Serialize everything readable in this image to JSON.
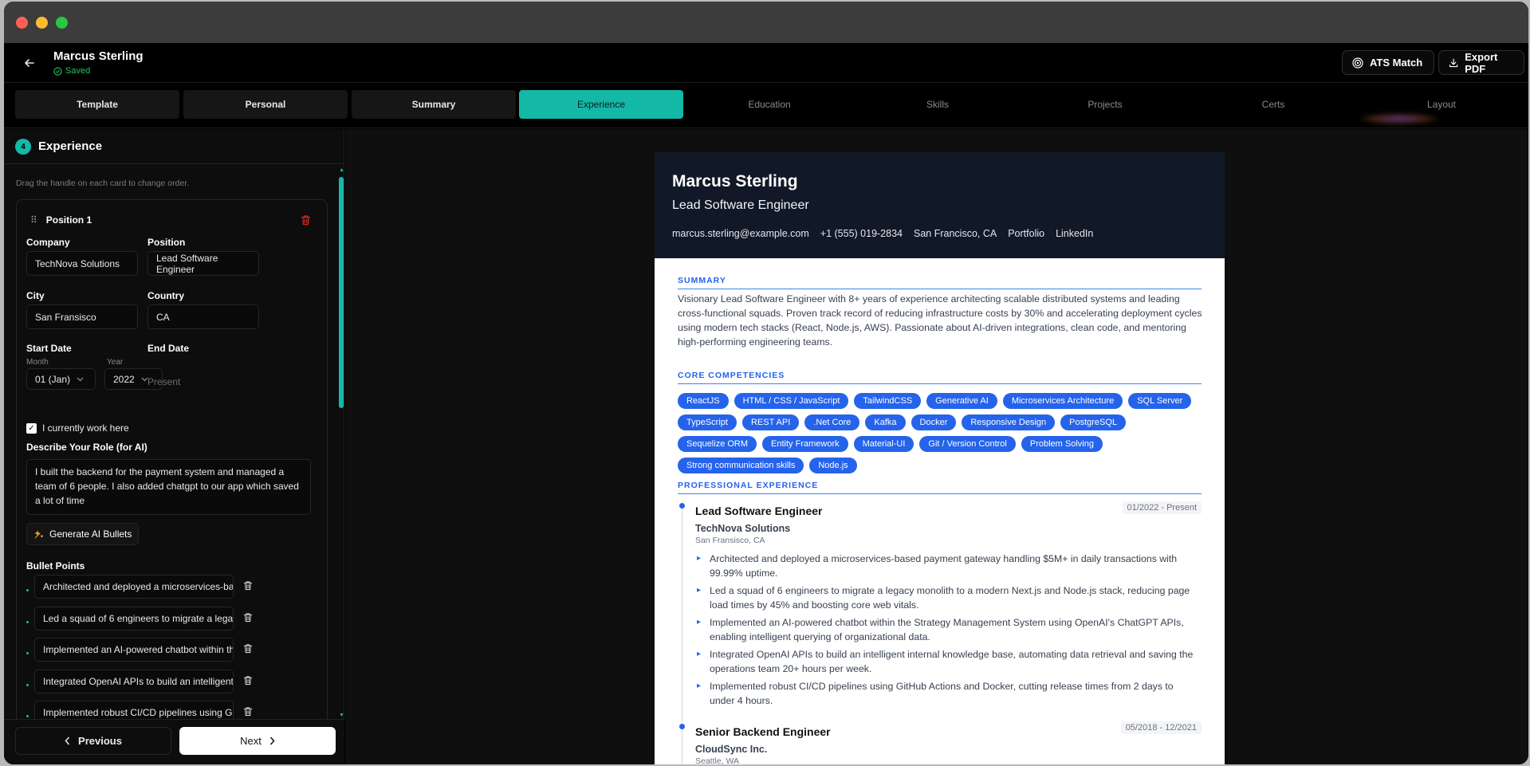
{
  "header": {
    "name": "Marcus Sterling",
    "status": "Saved",
    "ats_label": "ATS Match",
    "export_label": "Export PDF"
  },
  "tabs": [
    "Template",
    "Personal",
    "Summary",
    "Experience",
    "Education",
    "Skills",
    "Projects",
    "Certs",
    "Layout"
  ],
  "section": {
    "number": "4",
    "title": "Experience",
    "hint": "Drag the handle on each card to change order."
  },
  "position": {
    "title": "Position 1",
    "company_label": "Company",
    "company": "TechNova Solutions",
    "position_label": "Position",
    "position": "Lead Software Engineer",
    "city_label": "City",
    "city": "San Fransisco",
    "country_label": "Country",
    "country": "CA",
    "start_label": "Start Date",
    "month_label": "Month",
    "month": "01 (Jan)",
    "year_label": "Year",
    "year": "2022",
    "end_label": "End Date",
    "end_placeholder": "Present",
    "current_label": "I currently work here",
    "role_label": "Describe Your Role (for AI)",
    "role_text": "I built the backend for the payment system and managed a team of 6 people. I also added chatgpt to our app which saved a lot of time",
    "generate_label": "Generate AI Bullets",
    "bullets_label": "Bullet Points",
    "bullets": [
      "Architected and deployed a microservices-based payment gateway handling",
      "Led a squad of 6 engineers to migrate a legacy monolith",
      "Implemented an AI-powered chatbot within the Strategy",
      "Integrated OpenAI APIs to build an intelligent internal",
      "Implemented robust CI/CD pipelines using GitHub Actions"
    ]
  },
  "footer": {
    "prev": "Previous",
    "next": "Next"
  },
  "resume": {
    "name": "Marcus Sterling",
    "title": "Lead Software Engineer",
    "contact": [
      "marcus.sterling@example.com",
      "+1 (555) 019-2834",
      "San Francisco, CA",
      "Portfolio",
      "LinkedIn"
    ],
    "summary_heading": "SUMMARY",
    "summary": "Visionary Lead Software Engineer with 8+ years of experience architecting scalable distributed systems and leading cross-functional squads. Proven track record of reducing infrastructure costs by 30% and accelerating deployment cycles using modern tech stacks (React, Node.js, AWS). Passionate about AI-driven integrations, clean code, and mentoring high-performing engineering teams.",
    "skills_heading": "CORE COMPETENCIES",
    "skills": [
      "ReactJS",
      "HTML / CSS / JavaScript",
      "TailwindCSS",
      "Generative AI",
      "Microservices Architecture",
      "SQL Server",
      "TypeScript",
      "REST API",
      ".Net Core",
      "Kafka",
      "Docker",
      "Responsive Design",
      "PostgreSQL",
      "Sequelize ORM",
      "Entity Framework",
      "Material-UI",
      "Git / Version Control",
      "Problem Solving",
      "Strong communication skills",
      "Node.js"
    ],
    "experience_heading": "PROFESSIONAL EXPERIENCE",
    "jobs": [
      {
        "title": "Lead Software Engineer",
        "company": "TechNova Solutions",
        "location": "San Fransisco, CA",
        "dates": "01/2022 - Present",
        "bullets": [
          "Architected and deployed a microservices-based payment gateway handling $5M+ in daily transactions with 99.99% uptime.",
          "Led a squad of 6 engineers to migrate a legacy monolith to a modern Next.js and Node.js stack, reducing page load times by 45% and boosting core web vitals.",
          "Implemented an AI-powered chatbot within the Strategy Management System using OpenAI's ChatGPT APIs, enabling intelligent querying of organizational data.",
          "Integrated OpenAI APIs to build an intelligent internal knowledge base, automating data retrieval and saving the operations team 20+ hours per week.",
          "Implemented robust CI/CD pipelines using GitHub Actions and Docker, cutting release times from 2 days to under 4 hours."
        ]
      },
      {
        "title": "Senior Backend Engineer",
        "company": "CloudSync Inc.",
        "location": "Seattle, WA",
        "dates": "05/2018 - 12/2021",
        "bullets": []
      }
    ]
  }
}
